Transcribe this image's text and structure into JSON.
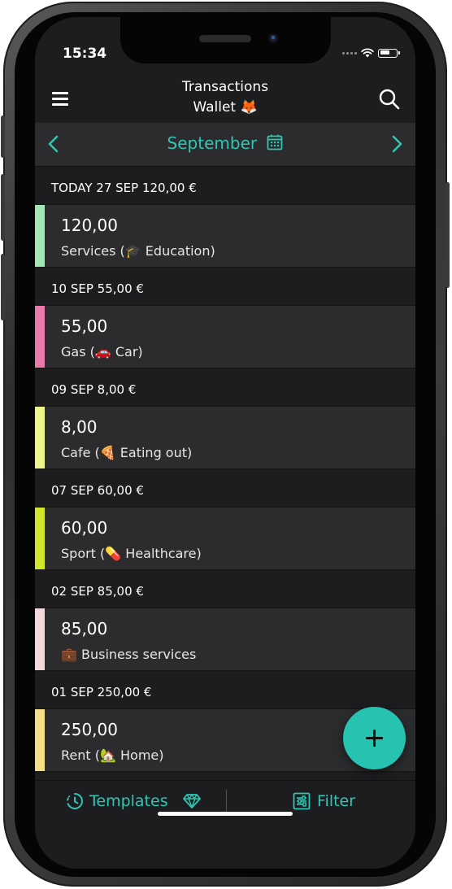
{
  "status_bar": {
    "time": "15:34"
  },
  "header": {
    "title": "Transactions",
    "subtitle": "Wallet 🦊"
  },
  "month_selector": {
    "label": "September"
  },
  "groups": [
    {
      "header": "TODAY 27 SEP 120,00 €",
      "amount": "120,00",
      "category": "Services (🎓 Education)",
      "color": "#a4e7b6"
    },
    {
      "header": "10 SEP 55,00 €",
      "amount": "55,00",
      "category": "Gas (🚗 Car)",
      "color": "#e978ab"
    },
    {
      "header": "09 SEP 8,00 €",
      "amount": "8,00",
      "category": "Cafe (🍕 Eating out)",
      "color": "#ecf48a"
    },
    {
      "header": "07 SEP 60,00 €",
      "amount": "60,00",
      "category": "Sport (💊 Healthcare)",
      "color": "#cfe62a"
    },
    {
      "header": "02 SEP 85,00 €",
      "amount": "85,00",
      "category": "💼 Business services",
      "color": "#f3d9d9"
    },
    {
      "header": "01 SEP 250,00 €",
      "amount": "250,00",
      "category": "Rent (🏡 Home)",
      "color": "#f6dd87"
    }
  ],
  "bottom_bar": {
    "templates_label": "Templates",
    "filter_label": "Filter"
  },
  "colors": {
    "accent": "#2ec6b4",
    "fab": "#25c3b0",
    "background": "#1d1d1f",
    "row": "#2c2c2e"
  }
}
